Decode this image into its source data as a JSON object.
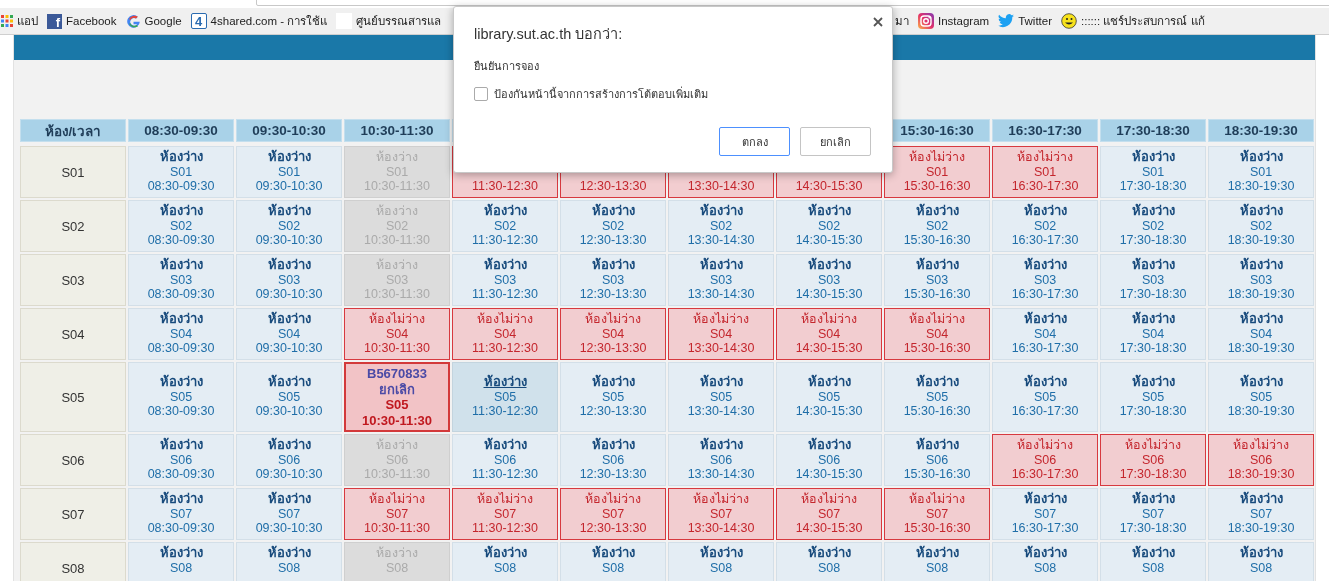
{
  "bookmarks": [
    {
      "kind": "apps",
      "label": "แอป"
    },
    {
      "kind": "facebook",
      "glyph": "f",
      "label": "Facebook"
    },
    {
      "kind": "google",
      "label": "Google"
    },
    {
      "kind": "boxed",
      "glyph": "4",
      "label": "4shared.com - การใช้แ"
    },
    {
      "kind": "blank",
      "label": "ศูนย์บรรณสารแล"
    },
    {
      "kind": "plain",
      "label": "มา"
    },
    {
      "kind": "instagram",
      "label": "Instagram"
    },
    {
      "kind": "twitter",
      "label": "Twitter"
    },
    {
      "kind": "smiley",
      "label": ":::::: แชร์ประสบการณ์ แก้"
    }
  ],
  "table": {
    "columns": [
      {
        "label": "ห้อง/เวลา"
      },
      {
        "label": "08:30-09:30"
      },
      {
        "label": "09:30-10:30"
      },
      {
        "label": "10:30-11:30"
      },
      {},
      {},
      {},
      {},
      {
        "label": "15:30-16:30"
      },
      {
        "label": "16:30-17:30"
      },
      {
        "label": "17:30-18:30"
      },
      {
        "label": "18:30-19:30"
      }
    ],
    "rows": [
      {
        "cells": [
          {
            "kind": "room",
            "room": "S01"
          },
          {
            "kind": "free",
            "status": "ห้องว่าง",
            "room": "S01",
            "time": "08:30-09:30"
          },
          {
            "kind": "free",
            "status": "ห้องว่าง",
            "room": "S01",
            "time": "09:30-10:30"
          },
          {
            "kind": "past",
            "status": "ห้องว่าง",
            "room": "S01",
            "time": "10:30-11:30"
          },
          {
            "kind": "busy",
            "time": "11:30-12:30"
          },
          {
            "kind": "busy",
            "time": "12:30-13:30"
          },
          {
            "kind": "busy",
            "time": "13:30-14:30"
          },
          {
            "kind": "busy",
            "time": "14:30-15:30"
          },
          {
            "kind": "busy",
            "status": "ห้องไม่ว่าง",
            "room": "S01",
            "time": "15:30-16:30"
          },
          {
            "kind": "busy",
            "status": "ห้องไม่ว่าง",
            "room": "S01",
            "time": "16:30-17:30"
          },
          {
            "kind": "free",
            "status": "ห้องว่าง",
            "room": "S01",
            "time": "17:30-18:30"
          },
          {
            "kind": "free",
            "status": "ห้องว่าง",
            "room": "S01",
            "time": "18:30-19:30"
          }
        ]
      },
      {
        "cells": [
          {
            "kind": "room",
            "room": "S02"
          },
          {
            "kind": "free",
            "status": "ห้องว่าง",
            "room": "S02",
            "time": "08:30-09:30"
          },
          {
            "kind": "free",
            "status": "ห้องว่าง",
            "room": "S02",
            "time": "09:30-10:30"
          },
          {
            "kind": "past",
            "status": "ห้องว่าง",
            "room": "S02",
            "time": "10:30-11:30"
          },
          {
            "kind": "free",
            "status": "ห้องว่าง",
            "room": "S02",
            "time": "11:30-12:30"
          },
          {
            "kind": "free",
            "status": "ห้องว่าง",
            "room": "S02",
            "time": "12:30-13:30"
          },
          {
            "kind": "free",
            "status": "ห้องว่าง",
            "room": "S02",
            "time": "13:30-14:30"
          },
          {
            "kind": "free",
            "status": "ห้องว่าง",
            "room": "S02",
            "time": "14:30-15:30"
          },
          {
            "kind": "free",
            "status": "ห้องว่าง",
            "room": "S02",
            "time": "15:30-16:30"
          },
          {
            "kind": "free",
            "status": "ห้องว่าง",
            "room": "S02",
            "time": "16:30-17:30"
          },
          {
            "kind": "free",
            "status": "ห้องว่าง",
            "room": "S02",
            "time": "17:30-18:30"
          },
          {
            "kind": "free",
            "status": "ห้องว่าง",
            "room": "S02",
            "time": "18:30-19:30"
          }
        ]
      },
      {
        "cells": [
          {
            "kind": "room",
            "room": "S03"
          },
          {
            "kind": "free",
            "status": "ห้องว่าง",
            "room": "S03",
            "time": "08:30-09:30"
          },
          {
            "kind": "free",
            "status": "ห้องว่าง",
            "room": "S03",
            "time": "09:30-10:30"
          },
          {
            "kind": "past",
            "status": "ห้องว่าง",
            "room": "S03",
            "time": "10:30-11:30"
          },
          {
            "kind": "free",
            "status": "ห้องว่าง",
            "room": "S03",
            "time": "11:30-12:30"
          },
          {
            "kind": "free",
            "status": "ห้องว่าง",
            "room": "S03",
            "time": "12:30-13:30"
          },
          {
            "kind": "free",
            "status": "ห้องว่าง",
            "room": "S03",
            "time": "13:30-14:30"
          },
          {
            "kind": "free",
            "status": "ห้องว่าง",
            "room": "S03",
            "time": "14:30-15:30"
          },
          {
            "kind": "free",
            "status": "ห้องว่าง",
            "room": "S03",
            "time": "15:30-16:30"
          },
          {
            "kind": "free",
            "status": "ห้องว่าง",
            "room": "S03",
            "time": "16:30-17:30"
          },
          {
            "kind": "free",
            "status": "ห้องว่าง",
            "room": "S03",
            "time": "17:30-18:30"
          },
          {
            "kind": "free",
            "status": "ห้องว่าง",
            "room": "S03",
            "time": "18:30-19:30"
          }
        ]
      },
      {
        "cells": [
          {
            "kind": "room",
            "room": "S04"
          },
          {
            "kind": "free",
            "status": "ห้องว่าง",
            "room": "S04",
            "time": "08:30-09:30"
          },
          {
            "kind": "free",
            "status": "ห้องว่าง",
            "room": "S04",
            "time": "09:30-10:30"
          },
          {
            "kind": "busy",
            "status": "ห้องไม่ว่าง",
            "room": "S04",
            "time": "10:30-11:30"
          },
          {
            "kind": "busy",
            "status": "ห้องไม่ว่าง",
            "room": "S04",
            "time": "11:30-12:30"
          },
          {
            "kind": "busy",
            "status": "ห้องไม่ว่าง",
            "room": "S04",
            "time": "12:30-13:30"
          },
          {
            "kind": "busy",
            "status": "ห้องไม่ว่าง",
            "room": "S04",
            "time": "13:30-14:30"
          },
          {
            "kind": "busy",
            "status": "ห้องไม่ว่าง",
            "room": "S04",
            "time": "14:30-15:30"
          },
          {
            "kind": "busy",
            "status": "ห้องไม่ว่าง",
            "room": "S04",
            "time": "15:30-16:30"
          },
          {
            "kind": "free",
            "status": "ห้องว่าง",
            "room": "S04",
            "time": "16:30-17:30"
          },
          {
            "kind": "free",
            "status": "ห้องว่าง",
            "room": "S04",
            "time": "17:30-18:30"
          },
          {
            "kind": "free",
            "status": "ห้องว่าง",
            "room": "S04",
            "time": "18:30-19:30"
          }
        ]
      },
      {
        "cells": [
          {
            "kind": "room",
            "room": "S05"
          },
          {
            "kind": "free",
            "status": "ห้องว่าง",
            "room": "S05",
            "time": "08:30-09:30"
          },
          {
            "kind": "free",
            "status": "ห้องว่าง",
            "room": "S05",
            "time": "09:30-10:30"
          },
          {
            "kind": "mine",
            "user": "B5670833",
            "action": "ยกเลิก",
            "room": "S05",
            "time": "10:30-11:30"
          },
          {
            "kind": "hover",
            "status": "ห้องว่าง",
            "room": "S05",
            "time": "11:30-12:30"
          },
          {
            "kind": "free",
            "status": "ห้องว่าง",
            "room": "S05",
            "time": "12:30-13:30"
          },
          {
            "kind": "free",
            "status": "ห้องว่าง",
            "room": "S05",
            "time": "13:30-14:30"
          },
          {
            "kind": "free",
            "status": "ห้องว่าง",
            "room": "S05",
            "time": "14:30-15:30"
          },
          {
            "kind": "free",
            "status": "ห้องว่าง",
            "room": "S05",
            "time": "15:30-16:30"
          },
          {
            "kind": "free",
            "status": "ห้องว่าง",
            "room": "S05",
            "time": "16:30-17:30"
          },
          {
            "kind": "free",
            "status": "ห้องว่าง",
            "room": "S05",
            "time": "17:30-18:30"
          },
          {
            "kind": "free",
            "status": "ห้องว่าง",
            "room": "S05",
            "time": "18:30-19:30"
          }
        ]
      },
      {
        "cells": [
          {
            "kind": "room",
            "room": "S06"
          },
          {
            "kind": "free",
            "status": "ห้องว่าง",
            "room": "S06",
            "time": "08:30-09:30"
          },
          {
            "kind": "free",
            "status": "ห้องว่าง",
            "room": "S06",
            "time": "09:30-10:30"
          },
          {
            "kind": "past",
            "status": "ห้องว่าง",
            "room": "S06",
            "time": "10:30-11:30"
          },
          {
            "kind": "free",
            "status": "ห้องว่าง",
            "room": "S06",
            "time": "11:30-12:30"
          },
          {
            "kind": "free",
            "status": "ห้องว่าง",
            "room": "S06",
            "time": "12:30-13:30"
          },
          {
            "kind": "free",
            "status": "ห้องว่าง",
            "room": "S06",
            "time": "13:30-14:30"
          },
          {
            "kind": "free",
            "status": "ห้องว่าง",
            "room": "S06",
            "time": "14:30-15:30"
          },
          {
            "kind": "free",
            "status": "ห้องว่าง",
            "room": "S06",
            "time": "15:30-16:30"
          },
          {
            "kind": "busy",
            "status": "ห้องไม่ว่าง",
            "room": "S06",
            "time": "16:30-17:30"
          },
          {
            "kind": "busy",
            "status": "ห้องไม่ว่าง",
            "room": "S06",
            "time": "17:30-18:30"
          },
          {
            "kind": "busy",
            "status": "ห้องไม่ว่าง",
            "room": "S06",
            "time": "18:30-19:30"
          }
        ]
      },
      {
        "cells": [
          {
            "kind": "room",
            "room": "S07"
          },
          {
            "kind": "free",
            "status": "ห้องว่าง",
            "room": "S07",
            "time": "08:30-09:30"
          },
          {
            "kind": "free",
            "status": "ห้องว่าง",
            "room": "S07",
            "time": "09:30-10:30"
          },
          {
            "kind": "busy",
            "status": "ห้องไม่ว่าง",
            "room": "S07",
            "time": "10:30-11:30"
          },
          {
            "kind": "busy",
            "status": "ห้องไม่ว่าง",
            "room": "S07",
            "time": "11:30-12:30"
          },
          {
            "kind": "busy",
            "status": "ห้องไม่ว่าง",
            "room": "S07",
            "time": "12:30-13:30"
          },
          {
            "kind": "busy",
            "status": "ห้องไม่ว่าง",
            "room": "S07",
            "time": "13:30-14:30"
          },
          {
            "kind": "busy",
            "status": "ห้องไม่ว่าง",
            "room": "S07",
            "time": "14:30-15:30"
          },
          {
            "kind": "busy",
            "status": "ห้องไม่ว่าง",
            "room": "S07",
            "time": "15:30-16:30"
          },
          {
            "kind": "free",
            "status": "ห้องว่าง",
            "room": "S07",
            "time": "16:30-17:30"
          },
          {
            "kind": "free",
            "status": "ห้องว่าง",
            "room": "S07",
            "time": "17:30-18:30"
          },
          {
            "kind": "free",
            "status": "ห้องว่าง",
            "room": "S07",
            "time": "18:30-19:30"
          }
        ]
      },
      {
        "cells": [
          {
            "kind": "room",
            "room": "S08"
          },
          {
            "kind": "free",
            "status": "ห้องว่าง",
            "room": "S08"
          },
          {
            "kind": "free",
            "status": "ห้องว่าง",
            "room": "S08"
          },
          {
            "kind": "past",
            "status": "ห้องว่าง",
            "room": "S08"
          },
          {
            "kind": "free",
            "status": "ห้องว่าง",
            "room": "S08"
          },
          {
            "kind": "free",
            "status": "ห้องว่าง",
            "room": "S08"
          },
          {
            "kind": "free",
            "status": "ห้องว่าง",
            "room": "S08"
          },
          {
            "kind": "free",
            "status": "ห้องว่าง",
            "room": "S08"
          },
          {
            "kind": "free",
            "status": "ห้องว่าง",
            "room": "S08"
          },
          {
            "kind": "free",
            "status": "ห้องว่าง",
            "room": "S08"
          },
          {
            "kind": "free",
            "status": "ห้องว่าง",
            "room": "S08"
          },
          {
            "kind": "free",
            "status": "ห้องว่าง",
            "room": "S08"
          }
        ]
      }
    ]
  },
  "dialog": {
    "title": "library.sut.ac.th บอกว่า:",
    "message": "ยืนยันการจอง",
    "checkbox": {
      "label": "ป้องกันหน้านี้จากการสร้างการโต้ตอบเพิ่มเติม",
      "checked": false
    },
    "buttons": [
      {
        "label": "ตกลง",
        "focused": true
      },
      {
        "label": "ยกเลิก",
        "focused": false
      }
    ]
  }
}
